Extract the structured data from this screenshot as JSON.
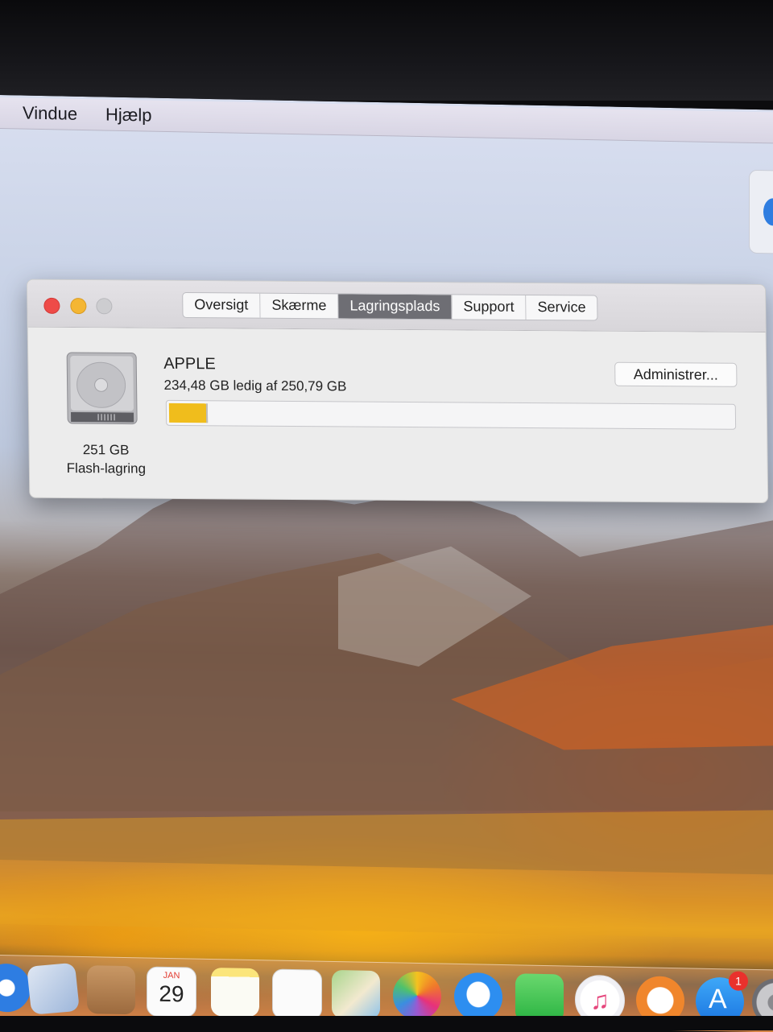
{
  "menubar": {
    "items": [
      "Vindue",
      "Hjælp"
    ]
  },
  "window": {
    "traffic_lights": [
      "close",
      "minimize",
      "zoom"
    ],
    "tabs": [
      {
        "label": "Oversigt",
        "active": false
      },
      {
        "label": "Skærme",
        "active": false
      },
      {
        "label": "Lagringsplads",
        "active": true
      },
      {
        "label": "Support",
        "active": false
      },
      {
        "label": "Service",
        "active": false
      }
    ],
    "storage": {
      "disk_size": "251 GB",
      "disk_type": "Flash-lagring",
      "volume_name": "APPLE",
      "free_text": "234,48 GB ledig af 250,79 GB",
      "used_fraction": 0.065,
      "used_color": "#f0bd1c",
      "manage_label": "Administrer..."
    }
  },
  "dock": {
    "calendar": {
      "month": "JAN",
      "day": "29"
    },
    "app_store_badge": "1",
    "items": [
      "safari-icon",
      "mail-icon",
      "contacts-icon",
      "calendar-icon",
      "notes-icon",
      "reminders-icon",
      "maps-icon",
      "photos-icon",
      "messages-icon",
      "facetime-icon",
      "itunes-icon",
      "ibooks-icon",
      "app-store-icon",
      "system-preferences-icon"
    ]
  }
}
